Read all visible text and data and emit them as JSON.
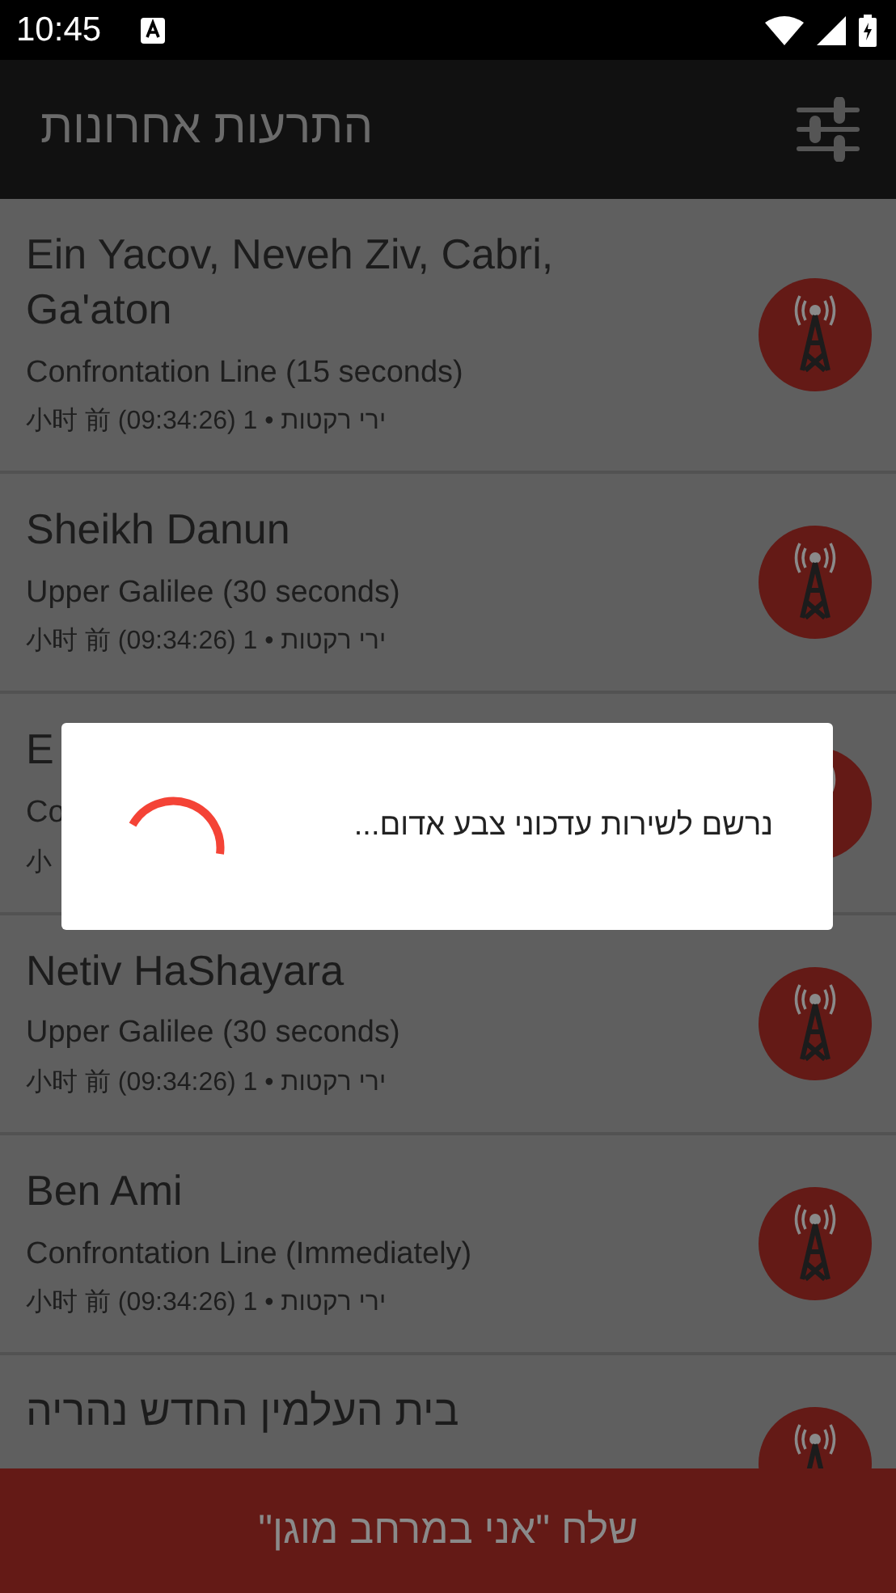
{
  "status_bar": {
    "time": "10:45"
  },
  "app_bar": {
    "title": "התרעות אחרונות"
  },
  "alerts": [
    {
      "title": "Ein Yacov, Neveh Ziv, Cabri, Ga'aton",
      "subtitle": "Confrontation Line (15 seconds)",
      "meta": "小时 前 (09:34:26) 1 • ירי רקטות"
    },
    {
      "title": "Sheikh Danun",
      "subtitle": "Upper Galilee (30 seconds)",
      "meta": "小时 前 (09:34:26) 1 • ירי רקטות"
    },
    {
      "title": "E",
      "subtitle": "Co",
      "meta": "小"
    },
    {
      "title": "Netiv HaShayara",
      "subtitle": "Upper Galilee (30 seconds)",
      "meta": "小时 前 (09:34:26) 1 • ירי רקטות"
    },
    {
      "title": "Ben Ami",
      "subtitle": "Confrontation Line (Immediately)",
      "meta": "小时 前 (09:34:26) 1 • ירי רקטות"
    },
    {
      "title": "בית העלמין החדש נהריה"
    }
  ],
  "dialog": {
    "message": "נרשם לשירות עדכוני צבע אדום..."
  },
  "bottom_button": {
    "label": "שלח \"אני במרחב מוגן\""
  }
}
